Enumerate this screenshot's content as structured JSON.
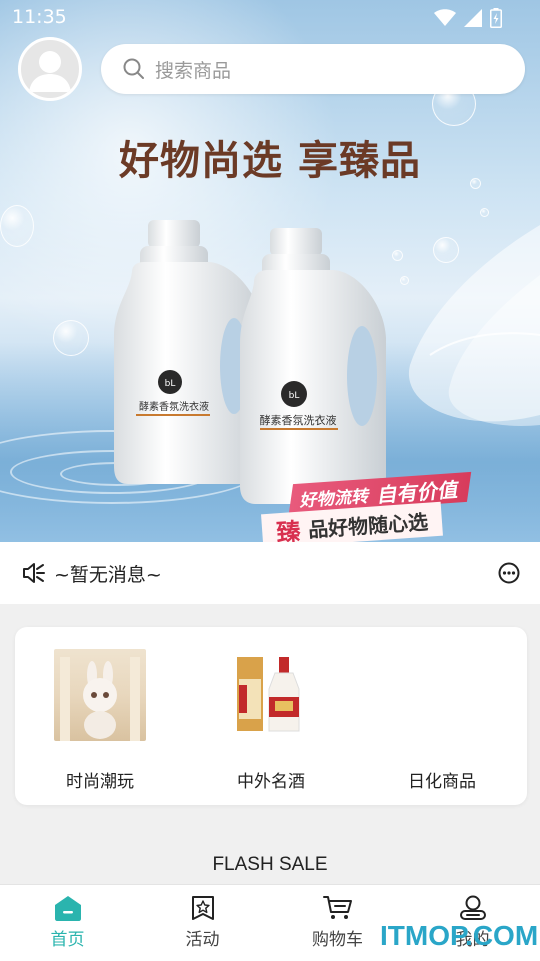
{
  "status_bar": {
    "time": "11:35"
  },
  "search": {
    "placeholder": "搜索商品"
  },
  "banner": {
    "headline": "好物尚选 享臻品",
    "bottle_label": "酵素香氛洗衣液",
    "ribbon_line1_a": "好物流转",
    "ribbon_line1_b": "自有价值",
    "ribbon_line2_a": "臻",
    "ribbon_line2_b": "品好物随心选"
  },
  "notice": {
    "text": "~暂无消息~"
  },
  "categories": [
    {
      "label": "时尚潮玩"
    },
    {
      "label": "中外名酒"
    },
    {
      "label": "日化商品"
    }
  ],
  "flash_sale": {
    "title": "FLASH SALE"
  },
  "tabbar": {
    "active_color": "#2ab4ae",
    "items": [
      {
        "label": "首页",
        "icon": "home-icon"
      },
      {
        "label": "活动",
        "icon": "star-badge-icon"
      },
      {
        "label": "购物车",
        "icon": "cart-icon"
      },
      {
        "label": "我的",
        "icon": "user-icon"
      }
    ]
  },
  "watermark": "ITMOP.COM"
}
